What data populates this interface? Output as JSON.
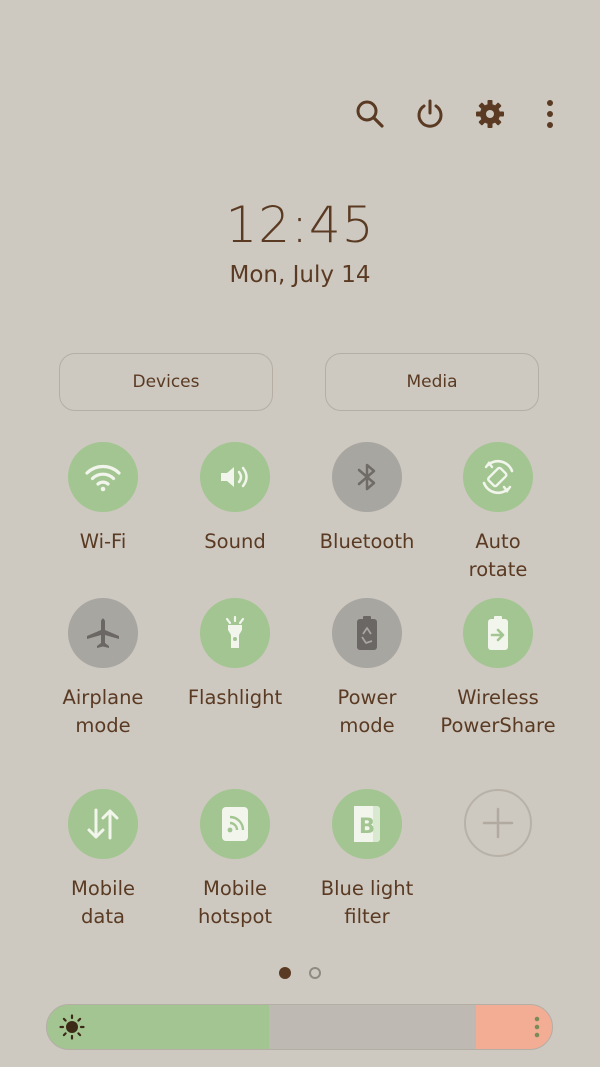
{
  "top_actions": [
    {
      "name": "search-icon"
    },
    {
      "name": "power-icon"
    },
    {
      "name": "settings-gear-icon"
    },
    {
      "name": "more-options-icon"
    }
  ],
  "clock": {
    "time": "12:45",
    "date": "Mon, July 14"
  },
  "pills": {
    "devices": "Devices",
    "media": "Media"
  },
  "tiles": [
    {
      "label": "Wi-Fi",
      "state": "on",
      "icon": "wifi-icon"
    },
    {
      "label": "Sound",
      "state": "on",
      "icon": "speaker-icon"
    },
    {
      "label": "Bluetooth",
      "state": "off",
      "icon": "bluetooth-icon"
    },
    {
      "label": "Auto\nrotate",
      "state": "on",
      "icon": "auto-rotate-icon"
    },
    {
      "label": "Airplane\nmode",
      "state": "off",
      "icon": "airplane-icon"
    },
    {
      "label": "Flashlight",
      "state": "on",
      "icon": "flashlight-icon"
    },
    {
      "label": "Power\nmode",
      "state": "off",
      "icon": "battery-recycle-icon"
    },
    {
      "label": "Wireless\nPowerShare",
      "state": "on",
      "icon": "wireless-powershare-icon"
    },
    {
      "label": "Mobile\ndata",
      "state": "on",
      "icon": "mobile-data-arrows-icon"
    },
    {
      "label": "Mobile\nhotspot",
      "state": "on",
      "icon": "hotspot-icon"
    },
    {
      "label": "Blue light\nfilter",
      "state": "on",
      "icon": "blue-light-filter-icon"
    },
    {
      "label": "",
      "state": "add",
      "icon": "add-icon"
    }
  ],
  "pagination": {
    "current_page": 1,
    "total_pages": 2
  },
  "brightness": {
    "level": 0.44,
    "icon": "sun-icon",
    "menu_icon": "vertical-dots-icon"
  },
  "colors": {
    "background": "#cdc8c0",
    "text": "#5a3a22",
    "tile_on": "#a3c591",
    "tile_off": "#a8a6a1",
    "brightness_fill": "#a3c591",
    "brightness_end": "#f3ad94"
  }
}
